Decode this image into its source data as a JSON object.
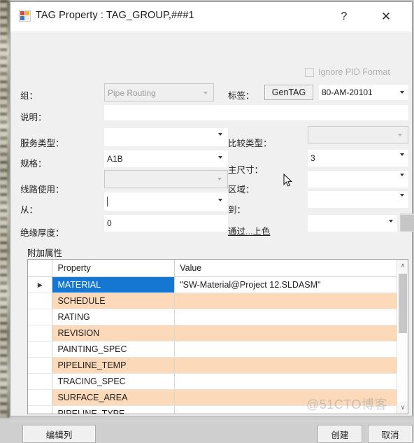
{
  "window": {
    "title": "TAG Property : TAG_GROUP,###1",
    "icon": "app-property-icon",
    "help_label": "?",
    "close_label": "✕"
  },
  "options": {
    "ignore_pid_format_label": "Ignore PID Format",
    "ignore_pid_format_checked": false,
    "ignore_pid_format_enabled": false
  },
  "form": {
    "group": {
      "label": "组：",
      "value": "Pipe Routing",
      "enabled": false
    },
    "tag": {
      "label": "标签：",
      "button_label": "GenTAG",
      "value": "80-AM-20101"
    },
    "description": {
      "label": "说明：",
      "value": ""
    },
    "service_type": {
      "label": "服务类型：",
      "value": ""
    },
    "comparison_type": {
      "label": "比较类型：",
      "value": "",
      "enabled": false
    },
    "specification": {
      "label": "规格：",
      "value": "A1B"
    },
    "main_size": {
      "label": "主尺寸：",
      "value": "3"
    },
    "line_usage": {
      "label": "线路使用：",
      "value": "",
      "enabled": false
    },
    "area": {
      "label": "区域：",
      "value": ""
    },
    "from": {
      "label": "从：",
      "value": ""
    },
    "to": {
      "label": "到：",
      "value": ""
    },
    "insulation_thickness": {
      "label": "绝缘厚度：",
      "value": "0"
    },
    "color_by": {
      "label": "通过...上色",
      "value": "",
      "swatch_color": "#c6c6c6"
    }
  },
  "extra_properties": {
    "section_title": "附加属性",
    "columns": [
      "Property",
      "Value"
    ],
    "selected_row_index": 0,
    "rows": [
      {
        "property": "MATERIAL",
        "value": "\"SW-Material@Project 12.SLDASM\""
      },
      {
        "property": "SCHEDULE",
        "value": ""
      },
      {
        "property": "RATING",
        "value": ""
      },
      {
        "property": "REVISION",
        "value": ""
      },
      {
        "property": "PAINTING_SPEC",
        "value": ""
      },
      {
        "property": "PIPELINE_TEMP",
        "value": ""
      },
      {
        "property": "TRACING_SPEC",
        "value": ""
      },
      {
        "property": "SURFACE_AREA",
        "value": ""
      },
      {
        "property": "PIPELINE_TYPE",
        "value": ""
      },
      {
        "property": "",
        "value": ""
      }
    ],
    "row_marker": "▶",
    "scrollbar": {
      "up": "∧",
      "down": "∨"
    }
  },
  "footer": {
    "edit_columns_label": "编辑列",
    "create_label": "创建",
    "cancel_label": "取消"
  },
  "watermark": {
    "text": "@51CTO博客"
  },
  "colors": {
    "accent_selection": "#1677d2",
    "row_alt": "#fbd9b9",
    "dialog_bg": "#f0f0f0"
  }
}
